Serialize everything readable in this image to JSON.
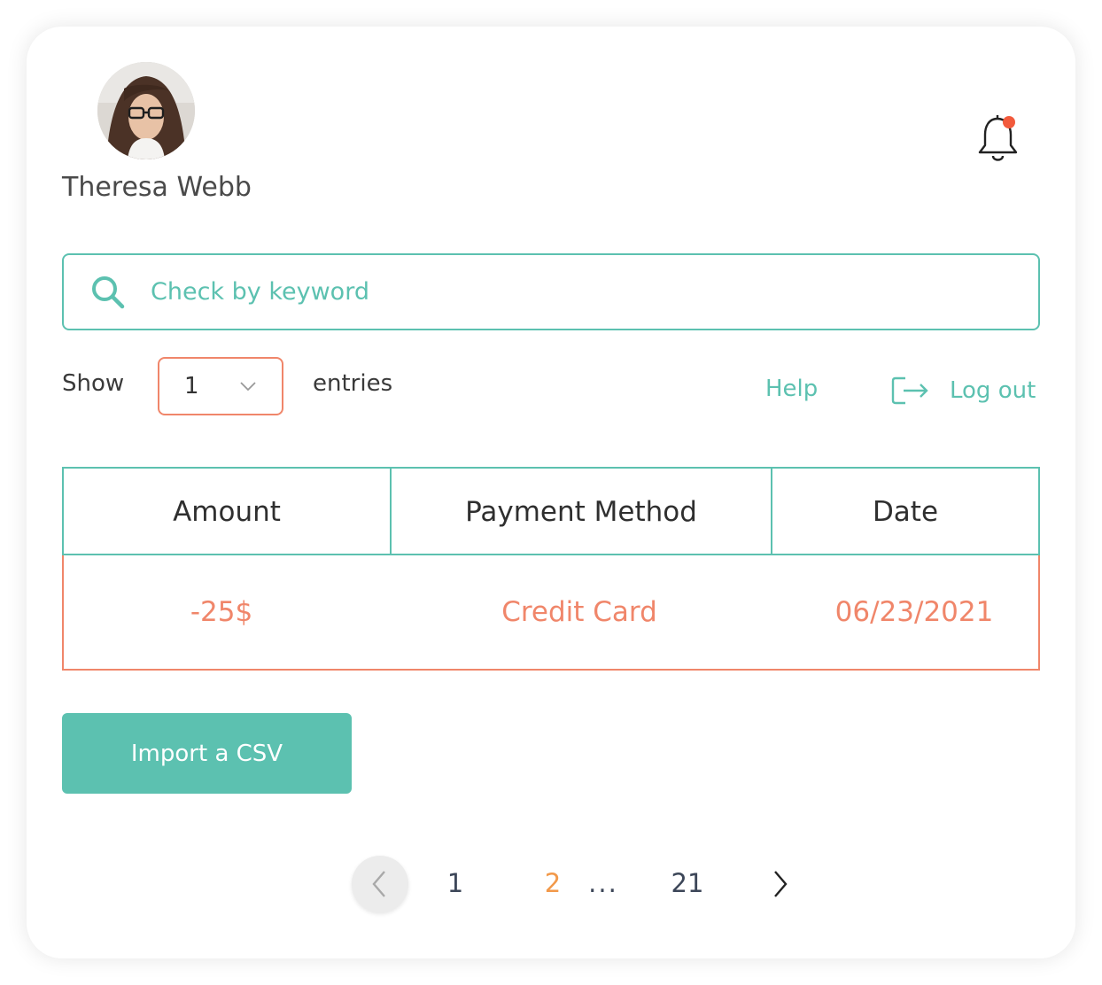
{
  "user": {
    "name": "Theresa Webb",
    "avatar_alt": "Theresa Webb avatar"
  },
  "header": {
    "notification_icon": "bell-icon",
    "has_unread": true
  },
  "search": {
    "placeholder": "Check by keyword",
    "value": "",
    "icon": "search-icon"
  },
  "entries": {
    "show_label": "Show",
    "selected": "1",
    "suffix_label": "entries"
  },
  "links": {
    "help": "Help",
    "logout": "Log out"
  },
  "table": {
    "headers": [
      "Amount",
      "Payment Method",
      "Date"
    ],
    "rows": [
      {
        "amount": "-25$",
        "method": "Credit Card",
        "date": "06/23/2021"
      }
    ]
  },
  "actions": {
    "import_label": "Import a CSV"
  },
  "pagination": {
    "pages": [
      "1",
      "2",
      "21"
    ],
    "ellipsis": "...",
    "current": "2"
  },
  "colors": {
    "accent": "#5cc1b0",
    "highlight": "#f0866a",
    "current_page": "#f2994a",
    "notification_dot": "#f25a3c"
  }
}
